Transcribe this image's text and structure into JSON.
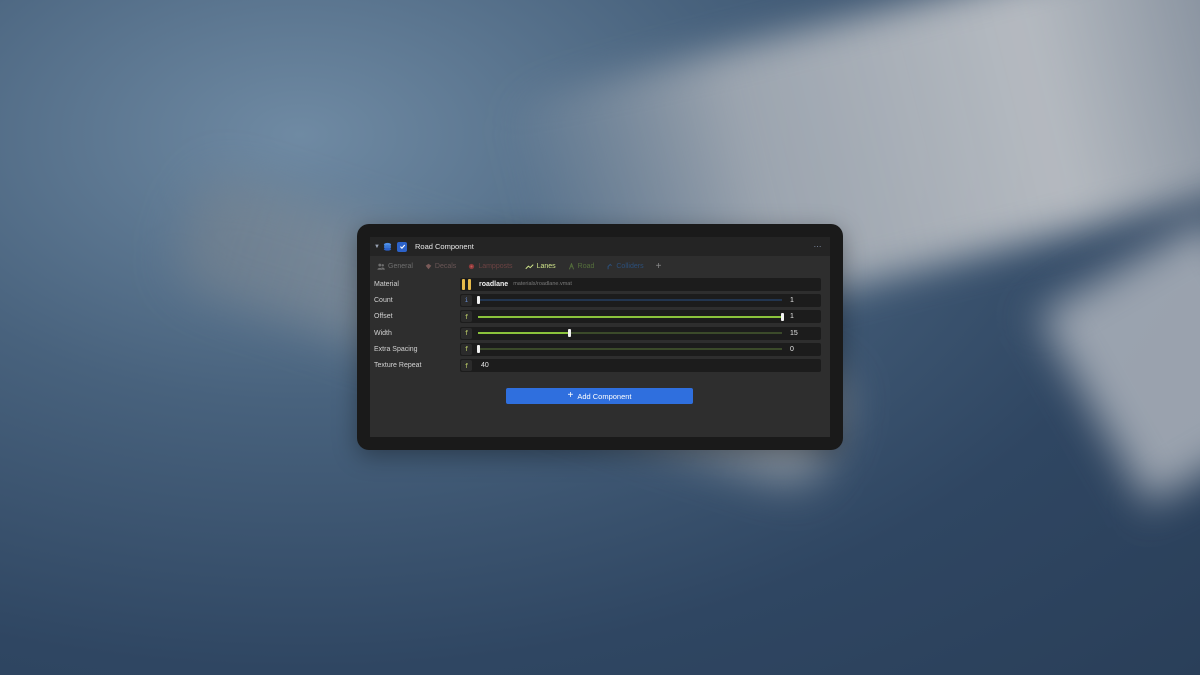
{
  "component": {
    "title": "Road Component",
    "enabled": true,
    "more_label": "⋯"
  },
  "tabs": [
    {
      "label": "General",
      "icon": "people-icon",
      "color": "#6f6f6f"
    },
    {
      "label": "Decals",
      "icon": "decal-icon",
      "color": "#6a5656"
    },
    {
      "label": "Lampposts",
      "icon": "lamppost-icon",
      "color": "#6d4343"
    },
    {
      "label": "Lanes",
      "icon": "lanes-icon",
      "color": "#cfe48a",
      "active": true
    },
    {
      "label": "Road",
      "icon": "road-icon",
      "color": "#55703c"
    },
    {
      "label": "Colliders",
      "icon": "collider-icon",
      "color": "#2c4f7a"
    }
  ],
  "add_tab_label": "+",
  "properties": {
    "material": {
      "label": "Material",
      "name": "roadlane",
      "path": "materials/roadlane.vmat",
      "swatch_color": "#e5b94a"
    },
    "count": {
      "label": "Count",
      "type_badge": "i",
      "value": "1",
      "slider_fraction": 0.0
    },
    "offset": {
      "label": "Offset",
      "type_badge": "f",
      "value": "1",
      "slider_fraction": 1.0
    },
    "width": {
      "label": "Width",
      "type_badge": "f",
      "value": "15",
      "slider_fraction": 0.3
    },
    "extra_spacing": {
      "label": "Extra Spacing",
      "type_badge": "f",
      "value": "0",
      "slider_fraction": 0.0
    },
    "texture_repeat": {
      "label": "Texture Repeat",
      "type_badge": "f",
      "value": "40"
    }
  },
  "add_component": {
    "plus": "+",
    "label": "Add Component",
    "color": "#2f6fde"
  }
}
